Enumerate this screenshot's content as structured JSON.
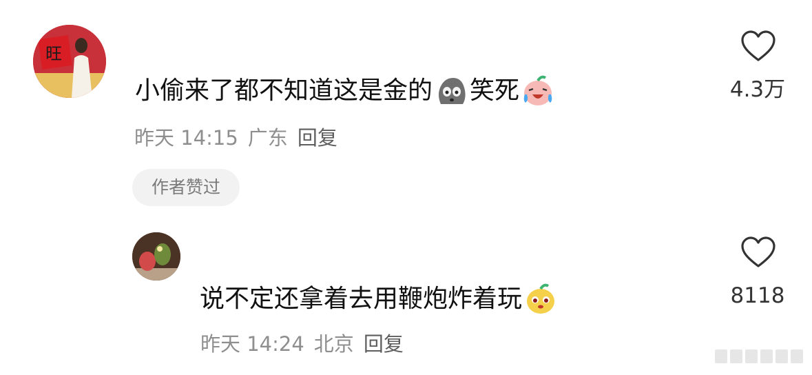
{
  "comments": [
    {
      "text_a": "小偷来了都不知道这是金的",
      "emoji_a": "gray-stone-face-emoji",
      "text_b": "笑死",
      "emoji_b": "crying-laughing-peach-emoji",
      "time": "昨天 14:15",
      "location": "广东",
      "reply_label": "回复",
      "badge": "作者赞过",
      "like_count": "4.3万",
      "like_icon": "heart-outline-icon"
    },
    {
      "text_a": "说不定还拿着去用鞭炮炸着玩",
      "emoji_a": "smug-yellow-blob-emoji",
      "time": "昨天 14:24",
      "location": "北京",
      "reply_label": "回复",
      "like_count": "8118",
      "like_icon": "heart-outline-icon"
    }
  ],
  "avatar_1_glyph": "旺",
  "colors": {
    "text": "#111111",
    "meta": "#8e8e8e",
    "badge_bg": "#f2f2f2",
    "heart_stroke": "#333333"
  }
}
